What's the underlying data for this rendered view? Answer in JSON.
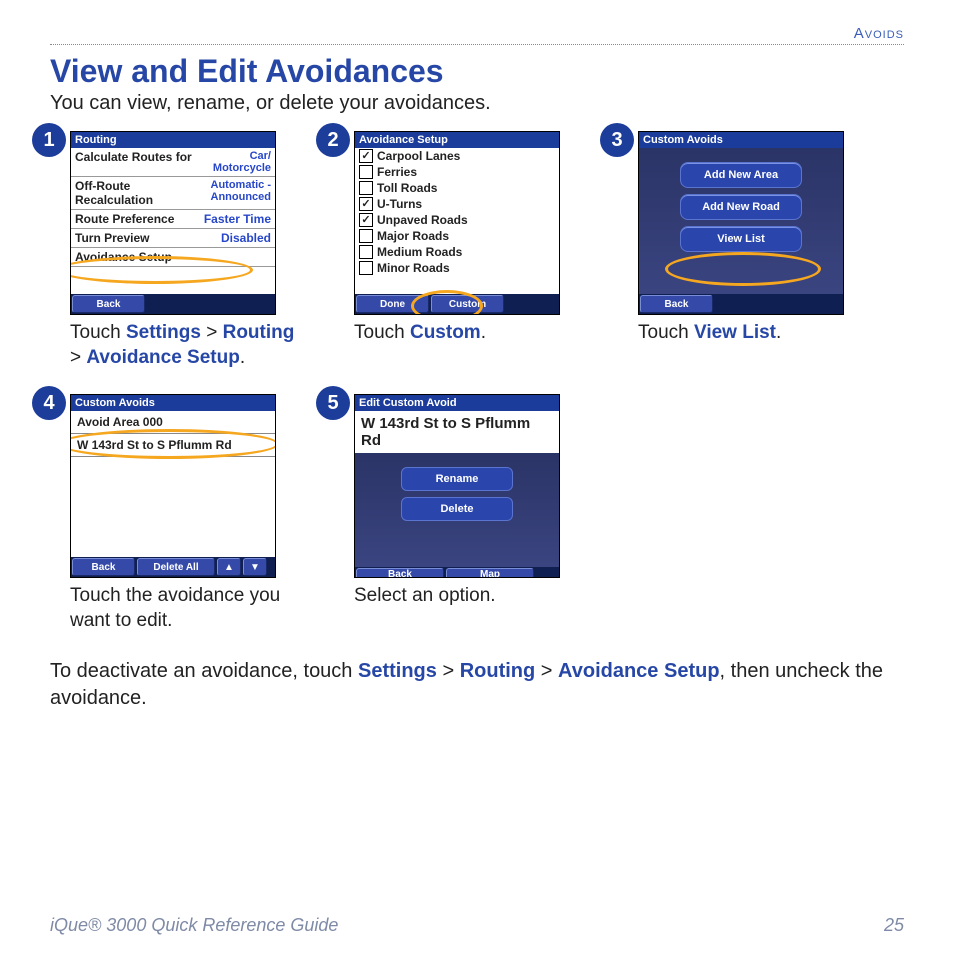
{
  "eyebrow": "Avoids",
  "heading": "View and Edit Avoidances",
  "intro": "You can view, rename, or delete your avoidances.",
  "step1": {
    "num": "1",
    "title": "Routing",
    "rows": [
      {
        "label": "Calculate Routes for",
        "value": "Car/\nMotorcycle"
      },
      {
        "label": "Off-Route\nRecalculation",
        "value": "Automatic -\nAnnounced"
      },
      {
        "label": "Route Preference",
        "value": "Faster Time"
      },
      {
        "label": "Turn Preview",
        "value": "Disabled"
      },
      {
        "label": "Avoidance Setup",
        "value": ""
      }
    ],
    "back": "Back",
    "cap_prefix": "Touch ",
    "kw1": "Settings",
    "sep1": " > ",
    "kw2": "Routing",
    "sep2": " > ",
    "kw3": "Avoidance Setup",
    "suffix": "."
  },
  "step2": {
    "num": "2",
    "title": "Avoidance Setup",
    "items": [
      {
        "checked": true,
        "label": "Carpool Lanes"
      },
      {
        "checked": false,
        "label": "Ferries"
      },
      {
        "checked": false,
        "label": "Toll Roads"
      },
      {
        "checked": true,
        "label": "U-Turns"
      },
      {
        "checked": true,
        "label": "Unpaved Roads"
      },
      {
        "checked": false,
        "label": "Major Roads"
      },
      {
        "checked": false,
        "label": "Medium Roads"
      },
      {
        "checked": false,
        "label": "Minor Roads"
      }
    ],
    "done": "Done",
    "custom": "Custom",
    "cap_prefix": "Touch ",
    "kw": "Custom",
    "suffix": "."
  },
  "step3": {
    "num": "3",
    "title": "Custom Avoids",
    "btn1": "Add New Area",
    "btn2": "Add New Road",
    "btn3": "View List",
    "back": "Back",
    "cap_prefix": "Touch ",
    "kw": "View List",
    "suffix": "."
  },
  "step4": {
    "num": "4",
    "title": "Custom Avoids",
    "items": [
      "Avoid Area 000",
      "W 143rd St to S Pflumm Rd"
    ],
    "back": "Back",
    "deleteall": "Delete All",
    "caption": "Touch the avoidance you want to edit."
  },
  "step5": {
    "num": "5",
    "title": "Edit Custom Avoid",
    "name": "W 143rd St to S Pflumm Rd",
    "rename": "Rename",
    "delete": "Delete",
    "back": "Back",
    "map": "Map",
    "caption": "Select an option."
  },
  "closing_a": "To deactivate an avoidance, touch ",
  "closing_kw1": "Settings",
  "closing_s1": " > ",
  "closing_kw2": "Routing",
  "closing_s2": " > ",
  "closing_kw3": "Avoidance Setup",
  "closing_b": ", then uncheck the avoidance.",
  "footer_left": "iQue® 3000 Quick Reference Guide",
  "footer_right": "25"
}
